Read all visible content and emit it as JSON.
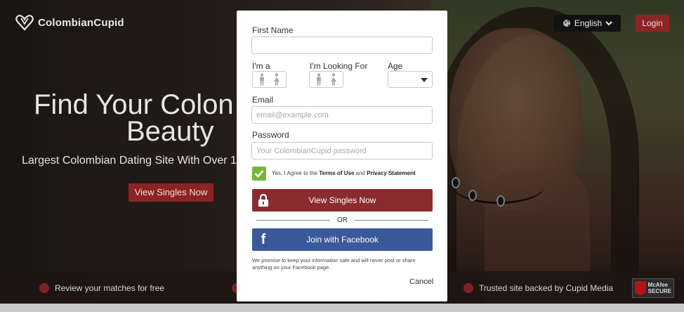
{
  "brand": {
    "name": "ColombianCupid",
    "accent": "#8b2426",
    "facebook_blue": "#3b5998",
    "check_green": "#7bb33c"
  },
  "header": {
    "language_label": "English",
    "language_icon": "globe-icon",
    "login_label": "Login"
  },
  "hero": {
    "headline_line1": "Find Your Colon",
    "headline_line2": "Beauty",
    "subheadline": "Largest Colombian Dating Site With Over 1",
    "cta_label": "View Singles Now"
  },
  "footer": {
    "features": [
      "Review your matches for free",
      "Trusted site backed by Cupid Media"
    ],
    "badge_brand": "McAfee",
    "badge_label": "SECURE"
  },
  "form": {
    "first_name_label": "First Name",
    "first_name_value": "",
    "im_a_label": "I'm a",
    "looking_for_label": "I'm Looking For",
    "age_label": "Age",
    "age_value": "",
    "email_label": "Email",
    "email_placeholder": "email@example.com",
    "password_label": "Password",
    "password_placeholder": "Your ColombianCupid password",
    "agree_prefix": "Yes, I Agree to the",
    "terms_link": "Terms of Use",
    "agree_and": "and",
    "privacy_link": "Privacy Statement",
    "agree_checked": true,
    "submit_label": "View Singles Now",
    "or_label": "OR",
    "facebook_label": "Join with Facebook",
    "promise_text": "We promise to keep your information safe and will never post or share anything on your Facebook page.",
    "cancel_label": "Cancel"
  }
}
